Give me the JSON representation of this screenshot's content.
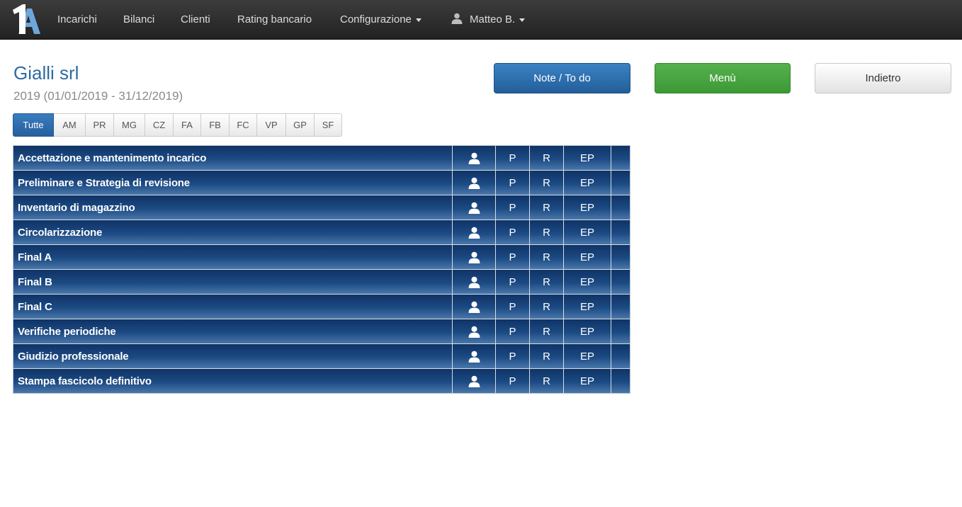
{
  "navbar": {
    "logo_text": "1A",
    "items": [
      {
        "label": "Incarichi"
      },
      {
        "label": "Bilanci"
      },
      {
        "label": "Clienti"
      },
      {
        "label": "Rating bancario"
      },
      {
        "label": "Configurazione"
      }
    ],
    "user": {
      "label": "Matteo B.",
      "icon": "user-icon"
    }
  },
  "header": {
    "title": "Gialli srl",
    "period": "2019 (01/01/2019 - 31/12/2019)"
  },
  "buttons": {
    "note": "Note / To do",
    "menu": "Menù",
    "back": "Indietro"
  },
  "tabs": [
    {
      "label": "Tutte",
      "active": true
    },
    {
      "label": "AM"
    },
    {
      "label": "PR"
    },
    {
      "label": "MG"
    },
    {
      "label": "CZ"
    },
    {
      "label": "FA"
    },
    {
      "label": "FB"
    },
    {
      "label": "FC"
    },
    {
      "label": "VP"
    },
    {
      "label": "GP"
    },
    {
      "label": "SF"
    }
  ],
  "phases": {
    "col_p": "P",
    "col_r": "R",
    "col_ep": "EP",
    "rows": [
      {
        "name": "Accettazione e mantenimento incarico"
      },
      {
        "name": "Preliminare e Strategia di revisione"
      },
      {
        "name": "Inventario di magazzino"
      },
      {
        "name": "Circolarizzazione"
      },
      {
        "name": "Final A"
      },
      {
        "name": "Final B"
      },
      {
        "name": "Final C"
      },
      {
        "name": "Verifiche periodiche"
      },
      {
        "name": "Giudizio professionale"
      },
      {
        "name": "Stampa fascicolo definitivo"
      }
    ]
  },
  "colors": {
    "navbar": "#2b2b2b",
    "title": "#2d6ca2",
    "note_button": "#2a6aad",
    "menu_button": "#46a33f",
    "row_background": "#1c4a83"
  }
}
